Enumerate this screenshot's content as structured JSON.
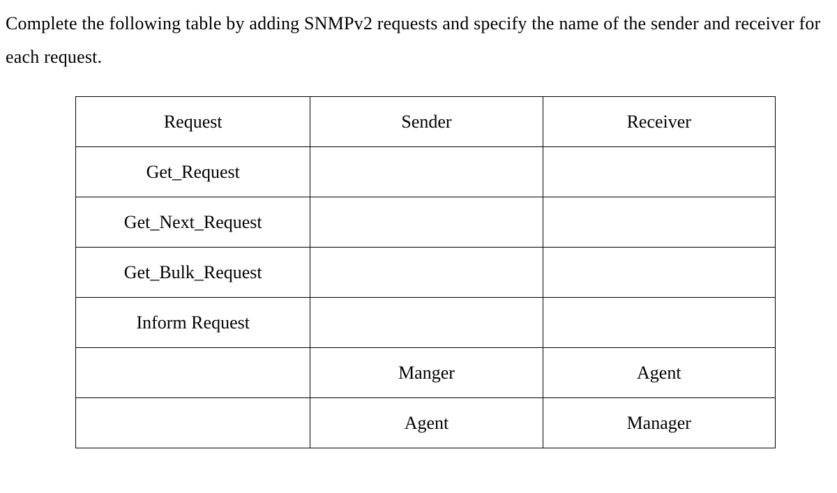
{
  "instruction": "Complete the following table by adding SNMPv2 requests and specify the name of the sender and receiver for each request.",
  "table": {
    "header": {
      "request": "Request",
      "sender": "Sender",
      "receiver": "Receiver"
    },
    "rows": [
      {
        "request": "Get_Request",
        "sender": "",
        "receiver": ""
      },
      {
        "request": "Get_Next_Request",
        "sender": "",
        "receiver": ""
      },
      {
        "request": "Get_Bulk_Request",
        "sender": "",
        "receiver": ""
      },
      {
        "request": "Inform Request",
        "sender": "",
        "receiver": ""
      },
      {
        "request": "",
        "sender": "Manger",
        "receiver": "Agent"
      },
      {
        "request": "",
        "sender": "Agent",
        "receiver": "Manager"
      }
    ]
  }
}
